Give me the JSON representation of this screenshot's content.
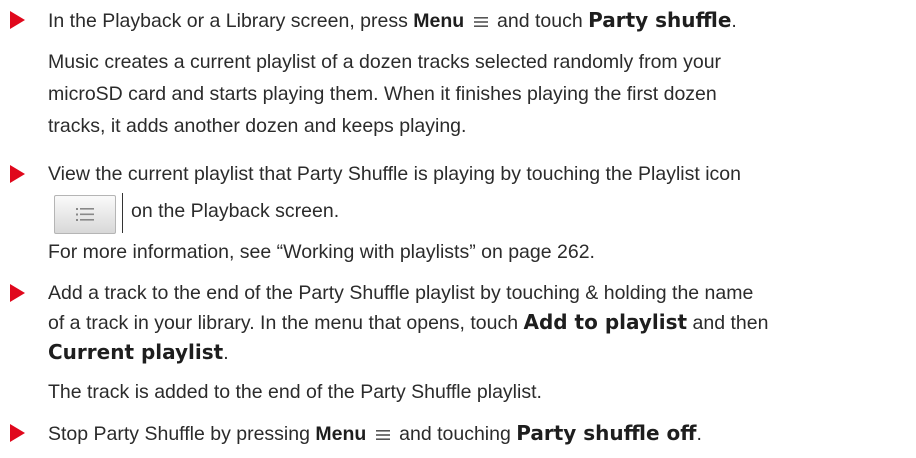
{
  "colors": {
    "bullet": "#e0081c",
    "text": "#2b2b2b"
  },
  "icons": [
    "menu-icon",
    "playlist-icon"
  ],
  "items": [
    {
      "pre": "In the Playback or a Library screen, press ",
      "bold1": "Menu",
      "mid": " and touch ",
      "bold2": "Party shuffle",
      "post": ".",
      "desc": [
        "Music creates a current playlist of a dozen tracks selected randomly from your",
        "microSD card and starts playing them. When it finishes playing the first dozen",
        "tracks, it adds another dozen and keeps playing."
      ]
    },
    {
      "line1": "View the current playlist that Party Shuffle is playing by touching the Playlist icon",
      "line2": "on the Playback screen.",
      "desc": "For more information, see “Working with playlists” on page 262."
    },
    {
      "line1": "Add a track to the end of the Party Shuffle playlist by touching & holding the name",
      "line2_pre": "of a track in your library. In the menu that opens, touch ",
      "line2_bold": "Add to playlist",
      "line2_post": " and then",
      "line3_bold": "Current playlist",
      "line3_post": ".",
      "desc": "The track is added to the end of the Party Shuffle playlist."
    },
    {
      "pre": "Stop Party Shuffle by pressing ",
      "bold1": "Menu",
      "mid": " and touching ",
      "bold2": "Party shuffle off",
      "post": "."
    }
  ]
}
